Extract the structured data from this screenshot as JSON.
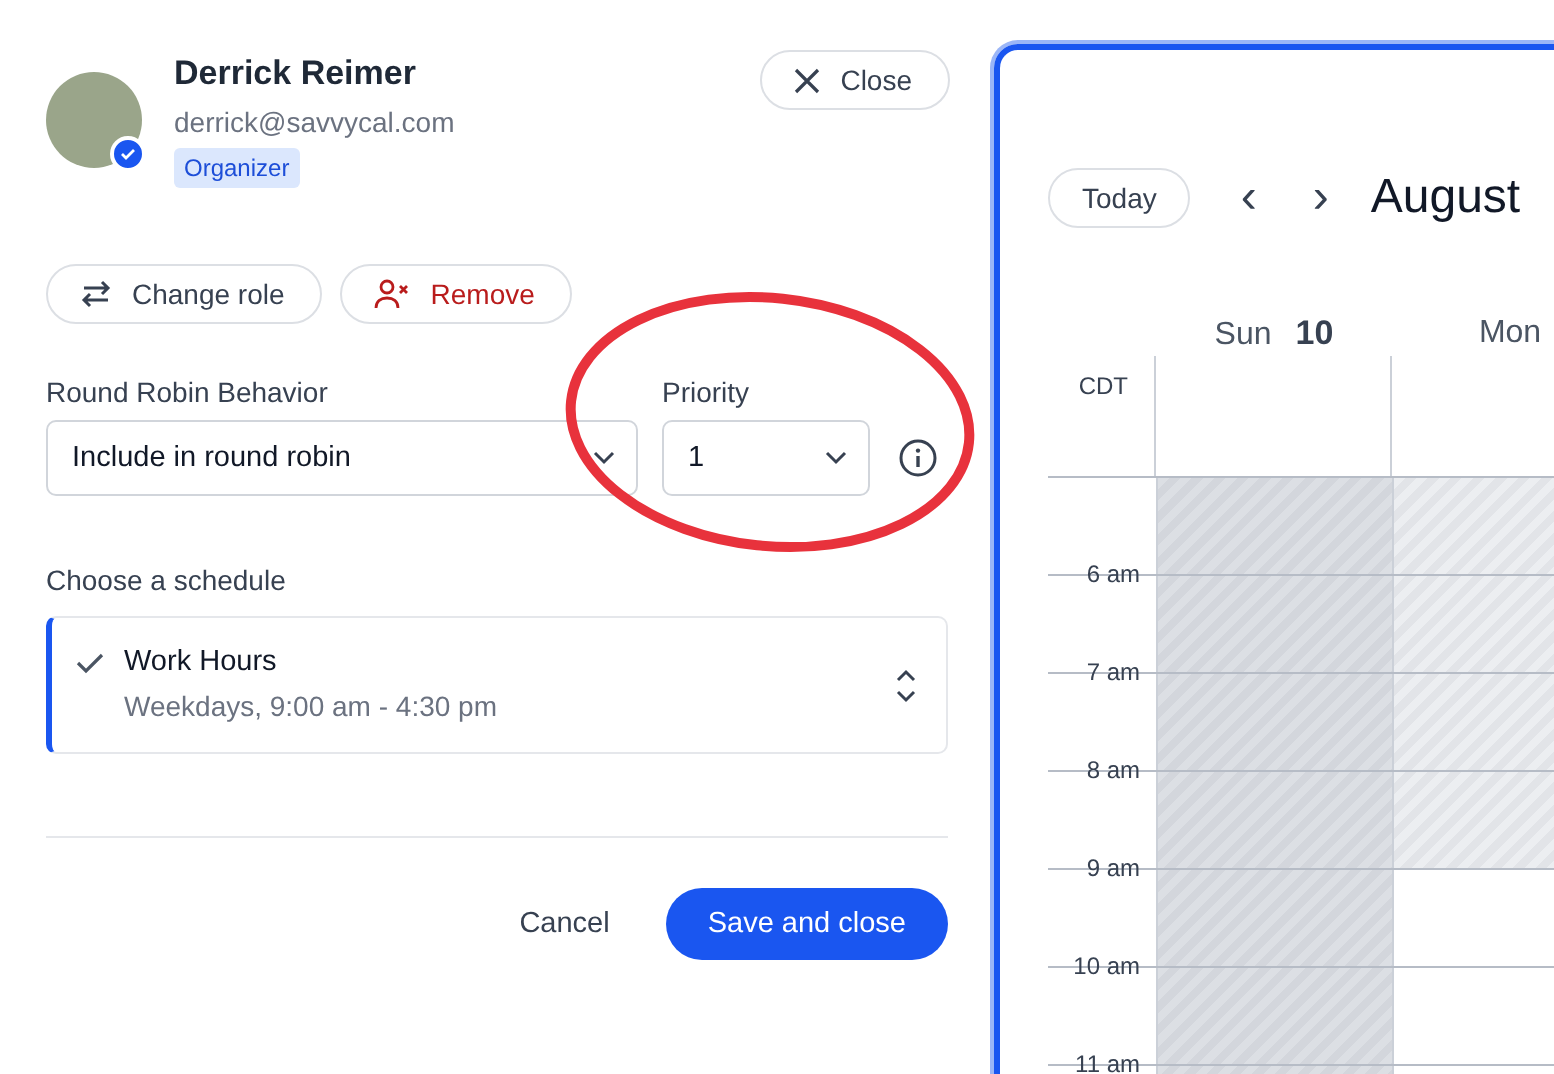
{
  "member": {
    "name": "Derrick Reimer",
    "email": "derrick@savvycal.com",
    "role_badge": "Organizer",
    "verified": true
  },
  "close_button": "Close",
  "actions": [
    {
      "kind": "neutral",
      "label": "Change role"
    },
    {
      "kind": "danger",
      "label": "Remove"
    }
  ],
  "round_robin": {
    "label": "Round Robin Behavior",
    "value": "Include in round robin"
  },
  "priority": {
    "label": "Priority",
    "value": "1"
  },
  "schedule": {
    "label": "Choose a schedule",
    "name": "Work Hours",
    "hours": "Weekdays, 9:00 am - 4:30 pm",
    "selected": true
  },
  "footer": {
    "cancel": "Cancel",
    "save": "Save and close"
  },
  "calendar": {
    "today_button": "Today",
    "prev": "‹",
    "next": "›",
    "month": "August",
    "timezone": "CDT",
    "hours": [
      "6 am",
      "7 am",
      "8 am",
      "9 am",
      "10 am",
      "11 am"
    ],
    "days": [
      {
        "weekday": "Sun",
        "date": "10",
        "weekend": true,
        "slots": [
          {
            "available": false
          },
          {
            "available": false
          },
          {
            "available": false
          },
          {
            "available": false
          },
          {
            "available": false
          },
          {
            "available": false
          },
          {
            "available": false
          }
        ]
      },
      {
        "weekday": "Mon",
        "weekend": false,
        "slots": [
          {
            "available": false
          },
          {
            "available": false
          },
          {
            "available": false
          },
          {
            "available": false
          },
          {
            "available": true
          },
          {
            "available": true
          },
          {
            "available": true
          }
        ]
      }
    ]
  }
}
